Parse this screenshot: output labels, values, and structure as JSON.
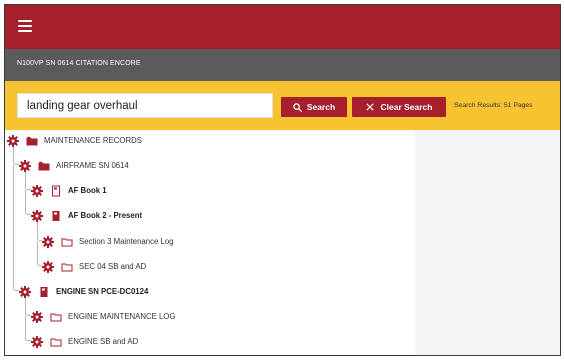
{
  "header": {
    "menu_icon": "hamburger-menu-icon"
  },
  "aircraft": {
    "title": "N100VP SN 0614 CITATION ENCORE"
  },
  "search": {
    "value": "landing gear overhaul",
    "search_label": "Search",
    "clear_label": "Clear Search",
    "results_text": "Search Results: 51 Pages"
  },
  "colors": {
    "brand": "#a51f2d",
    "subbar": "#5b5b5b",
    "search_bar": "#f7c331",
    "pane": "#f5f5f5"
  },
  "tree": [
    {
      "label": "MAINTENANCE RECORDS",
      "icon": "folder-filled-icon",
      "bold": false
    },
    {
      "label": "AIRFRAME SN 0614",
      "icon": "folder-filled-icon",
      "bold": false
    },
    {
      "label": "AF Book 1",
      "icon": "book-outline-icon",
      "bold": true
    },
    {
      "label": "AF Book 2 - Present",
      "icon": "book-filled-icon",
      "bold": true
    },
    {
      "label": "Section 3 Maintenance Log",
      "icon": "folder-outline-icon",
      "bold": false
    },
    {
      "label": "SEC 04 SB and AD",
      "icon": "folder-outline-icon",
      "bold": false
    },
    {
      "label": "ENGINE SN PCE-DC0124",
      "icon": "book-filled-icon",
      "bold": true
    },
    {
      "label": "ENGINE MAINTENANCE LOG",
      "icon": "folder-outline-icon",
      "bold": false
    },
    {
      "label": "ENGINE SB and AD",
      "icon": "folder-outline-icon",
      "bold": false
    }
  ]
}
